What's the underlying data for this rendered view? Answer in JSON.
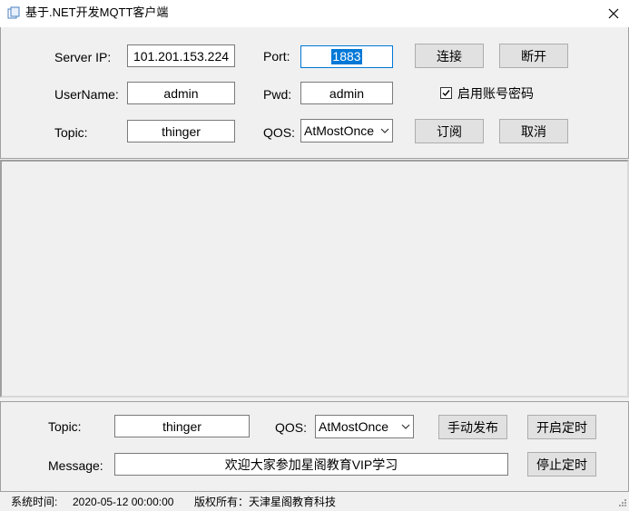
{
  "window": {
    "title": "基于.NET开发MQTT客户端",
    "close_glyph": "✕"
  },
  "connection": {
    "server_ip_label": "Server IP:",
    "server_ip_value": "101.201.153.224",
    "port_label": "Port:",
    "port_value": "1883",
    "username_label": "UserName:",
    "username_value": "admin",
    "pwd_label": "Pwd:",
    "pwd_value": "admin",
    "topic_label": "Topic:",
    "topic_value": "thinger",
    "qos_label": "QOS:",
    "qos_value": "AtMostOnce",
    "connect_button": "连接",
    "disconnect_button": "断开",
    "enable_auth_label": "启用账号密码",
    "enable_auth_checked": true,
    "subscribe_button": "订阅",
    "cancel_button": "取消"
  },
  "publish": {
    "topic_label": "Topic:",
    "topic_value": "thinger",
    "qos_label": "QOS:",
    "qos_value": "AtMostOnce",
    "message_label": "Message:",
    "message_value": "欢迎大家参加星阁教育VIP学习",
    "manual_publish_button": "手动发布",
    "start_timer_button": "开启定时",
    "stop_timer_button": "停止定时"
  },
  "status": {
    "time_label": "系统时间:",
    "time_value": "2020-05-12 00:00:00",
    "copyright": "版权所有：天津星阁教育科技"
  },
  "colors": {
    "accent": "#0078d7",
    "background": "#f0f0f0"
  }
}
